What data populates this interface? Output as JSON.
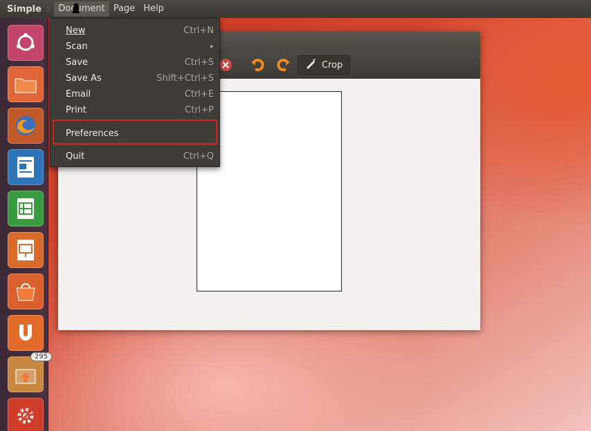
{
  "top_panel": {
    "app_name": "Simple",
    "separator": ":",
    "menus": [
      "Document",
      "Page",
      "Help"
    ]
  },
  "document_menu": {
    "items": [
      {
        "label": "New",
        "accel": "Ctrl+N"
      },
      {
        "label": "Scan",
        "accel": ""
      },
      {
        "label": "Save",
        "accel": "Ctrl+S"
      },
      {
        "label": "Save As",
        "accel": "Shift+Ctrl+S"
      },
      {
        "label": "Email",
        "accel": "Ctrl+E"
      },
      {
        "label": "Print",
        "accel": "Ctrl+P"
      },
      {
        "label": "Preferences",
        "accel": ""
      },
      {
        "label": "Quit",
        "accel": "Ctrl+Q"
      }
    ],
    "submenu_arrow": "▸"
  },
  "toolbar": {
    "crop_label": "Crop"
  },
  "launcher": {
    "items": [
      {
        "name": "dash-home-icon",
        "color": "#c4456a"
      },
      {
        "name": "files-icon",
        "color": "#e0663a"
      },
      {
        "name": "firefox-icon",
        "color": "#d75a2a"
      },
      {
        "name": "writer-icon",
        "color": "#2d74b8"
      },
      {
        "name": "calc-icon",
        "color": "#3a9a3f"
      },
      {
        "name": "impress-icon",
        "color": "#d86a2c"
      },
      {
        "name": "software-center-icon",
        "color": "#d9602c"
      },
      {
        "name": "ubuntu-one-icon",
        "color": "#e36b2a"
      },
      {
        "name": "update-manager-icon",
        "color": "#d4742f"
      },
      {
        "name": "system-settings-icon",
        "color": "#cf3c2a"
      }
    ],
    "update_count": "295"
  },
  "colors": {
    "highlight": "#d21f1f",
    "panel": "#3a3934",
    "menu_bg": "#3d3c37"
  }
}
